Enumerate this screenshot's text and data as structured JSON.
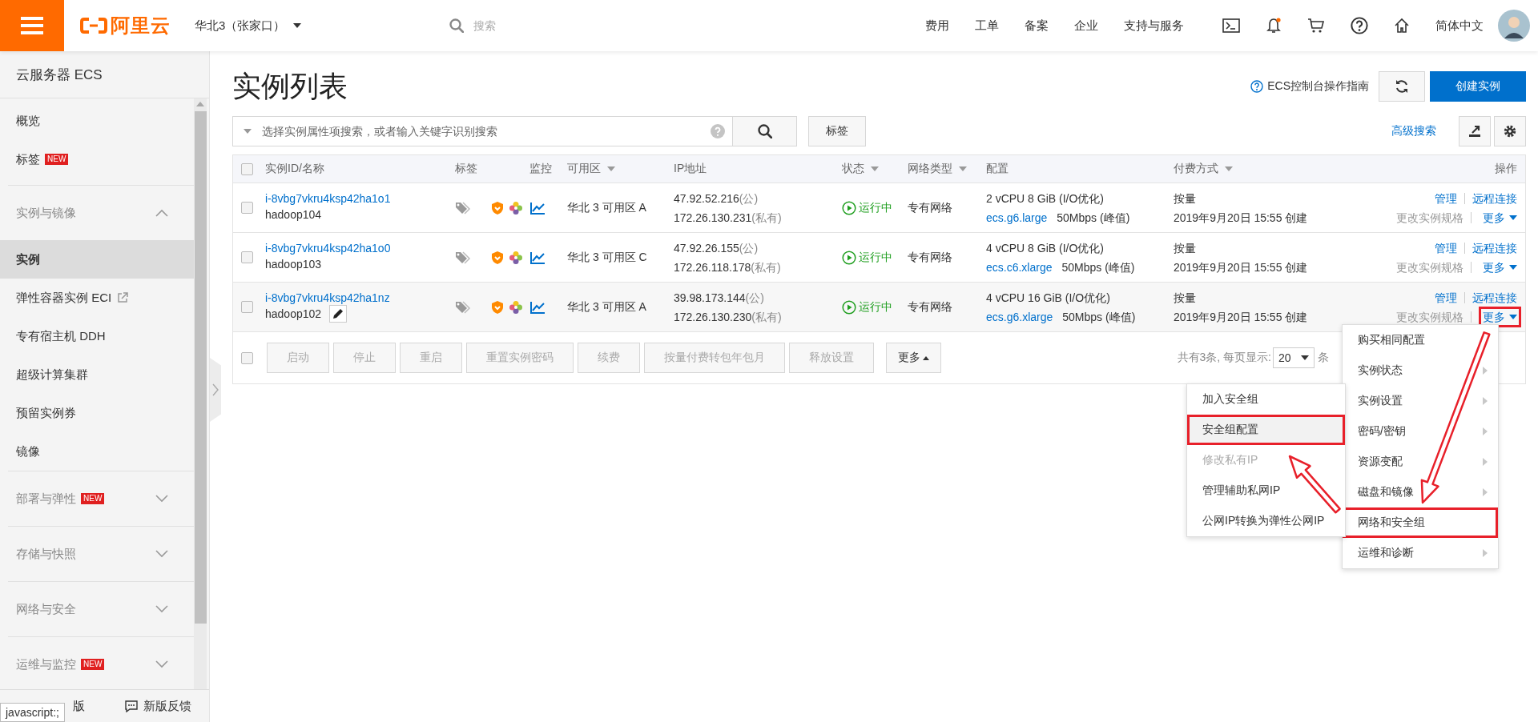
{
  "top_bar": {
    "logo_text": "阿里云",
    "region": "华北3（张家口）",
    "search_placeholder": "搜索",
    "nav": [
      "费用",
      "工单",
      "备案",
      "企业",
      "支持与服务"
    ],
    "notification_dot": true,
    "language": "简体中文"
  },
  "sidebar": {
    "title": "云服务器 ECS",
    "sections": [
      {
        "items": [
          {
            "label": "概览",
            "external": false,
            "selected": false
          },
          {
            "label": "标签",
            "badge": "NEW",
            "external": false,
            "selected": false
          }
        ]
      },
      {
        "header": "实例与镜像",
        "expanded": true,
        "items": [
          {
            "label": "实例",
            "external": false,
            "selected": true
          },
          {
            "label": "弹性容器实例 ECI",
            "external": true,
            "selected": false
          },
          {
            "label": "专有宿主机 DDH",
            "external": false,
            "selected": false
          },
          {
            "label": "超级计算集群",
            "external": false,
            "selected": false
          },
          {
            "label": "预留实例券",
            "external": false,
            "selected": false
          },
          {
            "label": "镜像",
            "external": false,
            "selected": false
          }
        ]
      },
      {
        "header": "部署与弹性",
        "badge": "NEW",
        "expanded": false
      },
      {
        "header": "存储与快照",
        "expanded": false
      },
      {
        "header": "网络与安全",
        "expanded": false
      },
      {
        "header": "运维与监控",
        "badge": "NEW",
        "expanded": false
      }
    ],
    "bottom": {
      "switch_visible": "版",
      "feedback": "新版反馈"
    },
    "tooltip": "javascript:;"
  },
  "page": {
    "title": "实例列表",
    "guide_link": "ECS控制台操作指南",
    "create_button": "创建实例",
    "search_placeholder": "选择实例属性项搜索，或者输入关键字识别搜索",
    "tag_button": "标签",
    "advanced_search": "高级搜索"
  },
  "table": {
    "columns": [
      {
        "label": "实例ID/名称",
        "sortable": false
      },
      {
        "label": "标签",
        "sortable": false
      },
      {
        "label": "监控",
        "sortable": false
      },
      {
        "label": "可用区",
        "sortable": true
      },
      {
        "label": "IP地址",
        "sortable": false
      },
      {
        "label": "状态",
        "sortable": true
      },
      {
        "label": "网络类型",
        "sortable": true
      },
      {
        "label": "配置",
        "sortable": false
      },
      {
        "label": "付费方式",
        "sortable": true
      },
      {
        "label": "操作",
        "sortable": false
      }
    ],
    "rows": [
      {
        "checked": false,
        "hovered": false,
        "id": "i-8vbg7vkru4ksp42ha1o1",
        "name": "hadoop104",
        "zone": "华北 3 可用区 A",
        "ip_public": "47.92.52.216",
        "ip_public_label": "(公)",
        "ip_private": "172.26.130.231",
        "ip_private_label": "(私有)",
        "status": "运行中",
        "network": "专有网络",
        "spec": "2 vCPU 8 GiB (I/O优化)",
        "type": "ecs.g6.large",
        "bandwidth": "50Mbps (峰值)",
        "billing": "按量",
        "created": "2019年9月20日 15:55 创建",
        "manage": "管理",
        "remote": "远程连接",
        "resize": "更改实例规格",
        "more": "更多",
        "more_highlighted": false
      },
      {
        "checked": false,
        "hovered": false,
        "id": "i-8vbg7vkru4ksp42ha1o0",
        "name": "hadoop103",
        "zone": "华北 3 可用区 C",
        "ip_public": "47.92.26.155",
        "ip_public_label": "(公)",
        "ip_private": "172.26.118.178",
        "ip_private_label": "(私有)",
        "status": "运行中",
        "network": "专有网络",
        "spec": "4 vCPU 8 GiB (I/O优化)",
        "type": "ecs.c6.xlarge",
        "bandwidth": "50Mbps (峰值)",
        "billing": "按量",
        "created": "2019年9月20日 15:55 创建",
        "manage": "管理",
        "remote": "远程连接",
        "resize": "更改实例规格",
        "more": "更多",
        "more_highlighted": false
      },
      {
        "checked": false,
        "hovered": true,
        "id": "i-8vbg7vkru4ksp42ha1nz",
        "name": "hadoop102",
        "zone": "华北 3 可用区 A",
        "ip_public": "39.98.173.144",
        "ip_public_label": "(公)",
        "ip_private": "172.26.130.230",
        "ip_private_label": "(私有)",
        "status": "运行中",
        "network": "专有网络",
        "spec": "4 vCPU 16 GiB (I/O优化)",
        "type": "ecs.g6.xlarge",
        "bandwidth": "50Mbps (峰值)",
        "billing": "按量",
        "created": "2019年9月20日 15:55 创建",
        "manage": "管理",
        "remote": "远程连接",
        "resize": "更改实例规格",
        "more": "更多",
        "more_highlighted": true
      }
    ],
    "footer": {
      "select_all_checked": false,
      "buttons": [
        {
          "label": "启动",
          "disabled": true
        },
        {
          "label": "停止",
          "disabled": true
        },
        {
          "label": "重启",
          "disabled": true
        },
        {
          "label": "重置实例密码",
          "disabled": true
        },
        {
          "label": "续费",
          "disabled": true
        },
        {
          "label": "按量付费转包年包月",
          "disabled": true
        },
        {
          "label": "释放设置",
          "disabled": true
        },
        {
          "label": "更多",
          "disabled": false
        }
      ],
      "summary": "共有3条, 每页显示:",
      "page_size": "20",
      "unit": "条"
    }
  },
  "more_menu": {
    "items": [
      {
        "label": "购买相同配置",
        "arrow": false,
        "highlighted": false
      },
      {
        "label": "实例状态",
        "arrow": true,
        "highlighted": false
      },
      {
        "label": "实例设置",
        "arrow": true,
        "highlighted": false
      },
      {
        "label": "密码/密钥",
        "arrow": true,
        "highlighted": false
      },
      {
        "label": "资源变配",
        "arrow": true,
        "highlighted": false
      },
      {
        "label": "磁盘和镜像",
        "arrow": true,
        "highlighted": false
      },
      {
        "label": "网络和安全组",
        "arrow": false,
        "highlighted": true
      },
      {
        "label": "运维和诊断",
        "arrow": true,
        "highlighted": false
      }
    ]
  },
  "submenu": {
    "items": [
      {
        "label": "加入安全组",
        "disabled": false,
        "hovered": false,
        "highlighted": false
      },
      {
        "label": "安全组配置",
        "disabled": false,
        "hovered": true,
        "highlighted": true
      },
      {
        "label": "修改私有IP",
        "disabled": true,
        "hovered": false,
        "highlighted": false
      },
      {
        "label": "管理辅助私网IP",
        "disabled": false,
        "hovered": false,
        "highlighted": false
      },
      {
        "label": "公网IP转换为弹性公网IP",
        "disabled": false,
        "hovered": false,
        "highlighted": false
      }
    ]
  }
}
